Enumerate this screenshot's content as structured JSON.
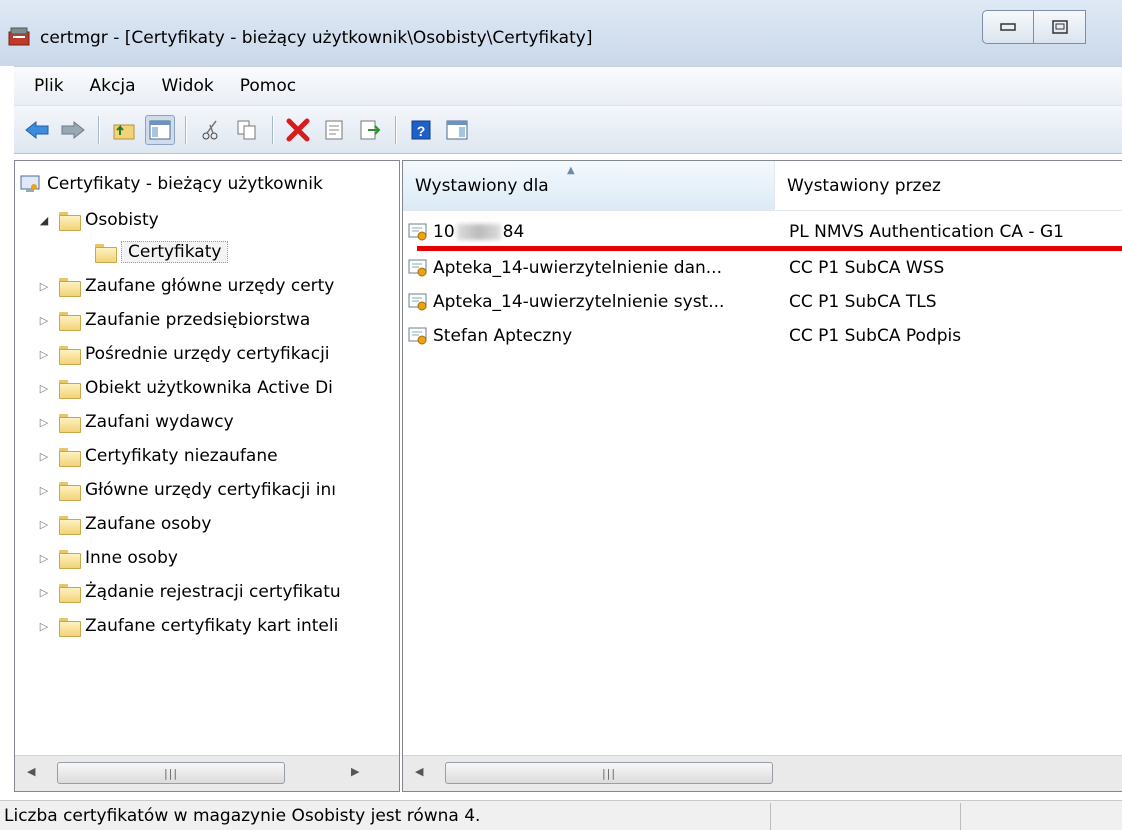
{
  "window": {
    "title": "certmgr - [Certyfikaty - bieżący użytkownik\\Osobisty\\Certyfikaty]"
  },
  "menu": [
    "Plik",
    "Akcja",
    "Widok",
    "Pomoc"
  ],
  "toolbar_icons": [
    "back-arrow-icon",
    "forward-arrow-icon",
    "up-folder-icon",
    "console-tree-icon",
    "cut-icon",
    "copy-icon",
    "delete-icon",
    "properties-icon",
    "export-list-icon",
    "help-icon",
    "action-pane-icon"
  ],
  "tree": {
    "root": "Certyfikaty - bieżący użytkownik",
    "items": [
      {
        "label": "Osobisty"
      },
      {
        "label": "Certyfikaty"
      },
      {
        "label": "Zaufane główne urzędy certy"
      },
      {
        "label": "Zaufanie przedsiębiorstwa"
      },
      {
        "label": "Pośrednie urzędy certyfikacji"
      },
      {
        "label": "Obiekt użytkownika Active Di"
      },
      {
        "label": "Zaufani wydawcy"
      },
      {
        "label": "Certyfikaty niezaufane"
      },
      {
        "label": "Główne urzędy certyfikacji inı"
      },
      {
        "label": "Zaufane osoby"
      },
      {
        "label": "Inne osoby"
      },
      {
        "label": "Żądanie rejestracji certyfikatu"
      },
      {
        "label": "Zaufane certyfikaty kart inteli"
      }
    ]
  },
  "list": {
    "columns": [
      "Wystawiony dla",
      "Wystawiony przez"
    ],
    "rows": [
      {
        "issued_to_prefix": "10",
        "issued_to_suffix": "84",
        "issued_by": "PL NMVS Authentication CA - G1"
      },
      {
        "issued_to": "Apteka_14-uwierzytelnienie dan...",
        "issued_by": "CC P1 SubCA WSS"
      },
      {
        "issued_to": "Apteka_14-uwierzytelnienie syst...",
        "issued_by": "CC P1 SubCA TLS"
      },
      {
        "issued_to": "Stefan Apteczny",
        "issued_by": "CC P1 SubCA Podpis"
      }
    ]
  },
  "status": "Liczba certyfikatów w magazynie Osobisty jest równa 4.",
  "colors": {
    "highlight_underline": "#e60000",
    "titlebar": "#cad8ea"
  }
}
